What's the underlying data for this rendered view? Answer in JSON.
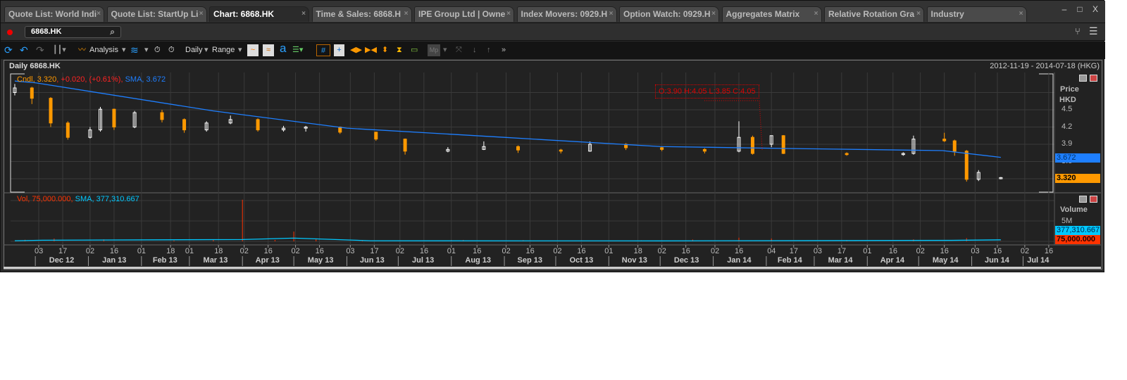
{
  "tabs": [
    {
      "label": "Quote List: World Indi",
      "active": false
    },
    {
      "label": "Quote List: StartUp Li",
      "active": false
    },
    {
      "label": "Chart: 6868.HK",
      "active": true
    },
    {
      "label": "Time & Sales: 6868.H",
      "active": false
    },
    {
      "label": "IPE Group Ltd | Owne",
      "active": false
    },
    {
      "label": "Index Movers: 0929.H",
      "active": false
    },
    {
      "label": "Option Watch: 0929.H",
      "active": false
    },
    {
      "label": "Aggregates Matrix",
      "active": false
    },
    {
      "label": "Relative Rotation Gra",
      "active": false
    },
    {
      "label": "Industry",
      "active": false
    }
  ],
  "window": {
    "minimize": "–",
    "maximize": "□",
    "close": "X"
  },
  "symbol": {
    "value": "6868.HK"
  },
  "toolbar": {
    "analysis": "Analysis",
    "interval": "Daily",
    "range": "Range",
    "font_icon": "a"
  },
  "chart": {
    "title": "Daily 6868.HK",
    "date_range": "2012-11-19 - 2014-07-18 (HKG)",
    "price_legend": {
      "name": "Cndl",
      "last": "3.320",
      "change": "+0.020",
      "pct": "(+0.61%)",
      "sma_name": "SMA",
      "sma": "3.672"
    },
    "tooltip": "O:3.90 H:4.05 L:3.85 C:4.05",
    "price_axis": {
      "title": "Price",
      "currency": "HKD",
      "ticks": [
        "4.5",
        "4.2",
        "3.9",
        "3.6"
      ],
      "last_tag": "3.320",
      "sma_tag": "3.672"
    },
    "vol_legend": {
      "name": "Vol",
      "last": "75,000.000",
      "sma_name": "SMA",
      "sma": "377,310.667"
    },
    "vol_axis": {
      "title": "Volume",
      "ticks": [
        "5M"
      ],
      "sma_tag": "377,310.667",
      "last_tag": "75,000.000"
    },
    "colors": {
      "up": "#ffffff",
      "down": "#ff9900",
      "sma": "#1e7fff",
      "vol": "#ff3300",
      "vol_sma": "#00c8ff"
    }
  },
  "chart_data": {
    "type": "candlestick",
    "candles": [
      [
        "2012-11-19",
        4.8,
        4.95,
        4.75,
        4.88
      ],
      [
        "2012-11-29",
        4.88,
        4.9,
        4.6,
        4.7
      ],
      [
        "2012-12-10",
        4.7,
        4.72,
        4.2,
        4.27
      ],
      [
        "2012-12-20",
        4.27,
        4.3,
        3.98,
        4.02
      ],
      [
        "2013-01-02",
        4.02,
        4.2,
        4.0,
        4.15
      ],
      [
        "2013-01-08",
        4.15,
        4.55,
        4.12,
        4.51
      ],
      [
        "2013-01-16",
        4.51,
        4.52,
        4.15,
        4.2
      ],
      [
        "2013-01-28",
        4.2,
        4.48,
        4.18,
        4.45
      ],
      [
        "2013-02-13",
        4.45,
        4.5,
        4.28,
        4.33
      ],
      [
        "2013-02-26",
        4.33,
        4.35,
        4.1,
        4.15
      ],
      [
        "2013-03-11",
        4.15,
        4.3,
        4.12,
        4.27
      ],
      [
        "2013-03-25",
        4.27,
        4.4,
        4.25,
        4.33
      ],
      [
        "2013-04-10",
        4.33,
        4.35,
        4.12,
        4.15
      ],
      [
        "2013-04-25",
        4.15,
        4.22,
        4.12,
        4.18
      ],
      [
        "2013-05-08",
        4.18,
        4.22,
        4.12,
        4.2
      ],
      [
        "2013-05-28",
        4.2,
        4.21,
        4.08,
        4.11
      ],
      [
        "2013-06-18",
        4.11,
        4.12,
        3.96,
        3.99
      ],
      [
        "2013-07-05",
        3.99,
        4.0,
        3.72,
        3.78
      ],
      [
        "2013-07-30",
        3.78,
        3.85,
        3.76,
        3.81
      ],
      [
        "2013-08-20",
        3.81,
        3.95,
        3.8,
        3.86
      ],
      [
        "2013-09-09",
        3.86,
        3.88,
        3.75,
        3.8
      ],
      [
        "2013-10-04",
        3.8,
        3.82,
        3.74,
        3.78
      ],
      [
        "2013-10-21",
        3.78,
        3.95,
        3.77,
        3.9
      ],
      [
        "2013-11-11",
        3.9,
        3.92,
        3.8,
        3.84
      ],
      [
        "2013-12-02",
        3.84,
        3.86,
        3.78,
        3.81
      ],
      [
        "2013-12-27",
        3.81,
        3.83,
        3.74,
        3.78
      ],
      [
        "2014-01-16",
        3.78,
        4.3,
        3.76,
        4.02
      ],
      [
        "2014-01-24",
        4.02,
        4.05,
        3.72,
        3.74
      ],
      [
        "2014-02-04",
        3.9,
        4.05,
        3.85,
        4.05
      ],
      [
        "2014-02-11",
        4.05,
        4.06,
        3.73,
        3.74
      ],
      [
        "2014-03-20",
        3.74,
        3.76,
        3.7,
        3.72
      ],
      [
        "2014-04-22",
        3.72,
        3.76,
        3.7,
        3.74
      ],
      [
        "2014-04-28",
        3.74,
        4.05,
        3.72,
        3.99
      ],
      [
        "2014-05-16",
        3.99,
        4.1,
        3.94,
        3.96
      ],
      [
        "2014-05-22",
        3.96,
        3.98,
        3.7,
        3.78
      ],
      [
        "2014-05-29",
        3.78,
        3.8,
        3.25,
        3.29
      ],
      [
        "2014-06-05",
        3.29,
        3.45,
        3.26,
        3.41
      ],
      [
        "2014-06-18",
        3.3,
        3.33,
        3.29,
        3.32
      ]
    ],
    "sma": [
      [
        "2012-11-19",
        5.0
      ],
      [
        "2012-12-01",
        4.97
      ],
      [
        "2013-03-15",
        4.48
      ],
      [
        "2013-06-01",
        4.18
      ],
      [
        "2013-09-01",
        4.02
      ],
      [
        "2013-12-01",
        3.86
      ],
      [
        "2014-03-01",
        3.82
      ],
      [
        "2014-05-15",
        3.79
      ],
      [
        "2014-06-18",
        3.672
      ]
    ],
    "volume": [
      [
        "2012-11-25",
        400000
      ],
      [
        "2012-12-12",
        700000
      ],
      [
        "2013-01-10",
        500000
      ],
      [
        "2013-02-20",
        200000
      ],
      [
        "2013-03-15",
        400000
      ],
      [
        "2013-04-01",
        10200000
      ],
      [
        "2013-04-20",
        350000
      ],
      [
        "2013-05-01",
        2400000
      ],
      [
        "2013-05-14",
        600000
      ],
      [
        "2013-06-10",
        250000
      ],
      [
        "2013-08-01",
        300000
      ],
      [
        "2013-08-08",
        350000
      ],
      [
        "2013-09-12",
        300000
      ],
      [
        "2013-11-20",
        250000
      ],
      [
        "2013-12-20",
        450000
      ],
      [
        "2014-01-16",
        900000
      ],
      [
        "2014-02-04",
        700000
      ],
      [
        "2014-03-20",
        300000
      ],
      [
        "2014-04-28",
        500000
      ],
      [
        "2014-05-29",
        800000
      ],
      [
        "2014-06-18",
        75000
      ]
    ],
    "volume_sma": [
      [
        "2012-11-19",
        150000
      ],
      [
        "2012-12-05",
        280000
      ],
      [
        "2013-04-01",
        450000
      ],
      [
        "2013-05-01",
        800000
      ],
      [
        "2013-06-15",
        150000
      ],
      [
        "2013-12-01",
        120000
      ],
      [
        "2014-05-20",
        250000
      ],
      [
        "2014-06-18",
        377310.667
      ]
    ],
    "price_range": [
      3.2,
      5.0
    ],
    "volume_range": [
      0,
      11000000
    ],
    "day_ticks": [
      [
        "2012-12-03",
        "03"
      ],
      [
        "2012-12-17",
        "17"
      ],
      [
        "2013-01-02",
        "02"
      ],
      [
        "2013-01-16",
        "16"
      ],
      [
        "2013-02-01",
        "01"
      ],
      [
        "2013-02-18",
        "18"
      ],
      [
        "2013-03-01",
        "01"
      ],
      [
        "2013-03-18",
        "18"
      ],
      [
        "2013-04-02",
        "02"
      ],
      [
        "2013-04-16",
        "16"
      ],
      [
        "2013-05-02",
        "02"
      ],
      [
        "2013-05-16",
        "16"
      ],
      [
        "2013-06-03",
        "03"
      ],
      [
        "2013-06-17",
        "17"
      ],
      [
        "2013-07-02",
        "02"
      ],
      [
        "2013-07-16",
        "16"
      ],
      [
        "2013-08-01",
        "01"
      ],
      [
        "2013-08-16",
        "16"
      ],
      [
        "2013-09-02",
        "02"
      ],
      [
        "2013-09-16",
        "16"
      ],
      [
        "2013-10-02",
        "02"
      ],
      [
        "2013-10-16",
        "16"
      ],
      [
        "2013-11-01",
        "01"
      ],
      [
        "2013-11-18",
        "18"
      ],
      [
        "2013-12-02",
        "02"
      ],
      [
        "2013-12-16",
        "16"
      ],
      [
        "2014-01-02",
        "02"
      ],
      [
        "2014-01-16",
        "16"
      ],
      [
        "2014-02-04",
        "04"
      ],
      [
        "2014-02-17",
        "17"
      ],
      [
        "2014-03-03",
        "03"
      ],
      [
        "2014-03-17",
        "17"
      ],
      [
        "2014-04-01",
        "01"
      ],
      [
        "2014-04-16",
        "16"
      ],
      [
        "2014-05-02",
        "02"
      ],
      [
        "2014-05-16",
        "16"
      ],
      [
        "2014-06-03",
        "03"
      ],
      [
        "2014-06-16",
        "16"
      ],
      [
        "2014-07-02",
        "02"
      ],
      [
        "2014-07-16",
        "16"
      ]
    ],
    "month_labels": [
      [
        "2012-12-01",
        "Dec 12"
      ],
      [
        "2013-01-01",
        "Jan 13"
      ],
      [
        "2013-02-01",
        "Feb 13"
      ],
      [
        "2013-03-01",
        "Mar 13"
      ],
      [
        "2013-04-01",
        "Apr 13"
      ],
      [
        "2013-05-01",
        "May 13"
      ],
      [
        "2013-06-01",
        "Jun 13"
      ],
      [
        "2013-07-01",
        "Jul 13"
      ],
      [
        "2013-08-01",
        "Aug 13"
      ],
      [
        "2013-09-01",
        "Sep 13"
      ],
      [
        "2013-10-01",
        "Oct 13"
      ],
      [
        "2013-11-01",
        "Nov 13"
      ],
      [
        "2013-12-01",
        "Dec 13"
      ],
      [
        "2014-01-01",
        "Jan 14"
      ],
      [
        "2014-02-01",
        "Feb 14"
      ],
      [
        "2014-03-01",
        "Mar 14"
      ],
      [
        "2014-04-01",
        "Apr 14"
      ],
      [
        "2014-05-01",
        "May 14"
      ],
      [
        "2014-06-01",
        "Jun 14"
      ],
      [
        "2014-07-01",
        "Jul 14"
      ]
    ]
  }
}
